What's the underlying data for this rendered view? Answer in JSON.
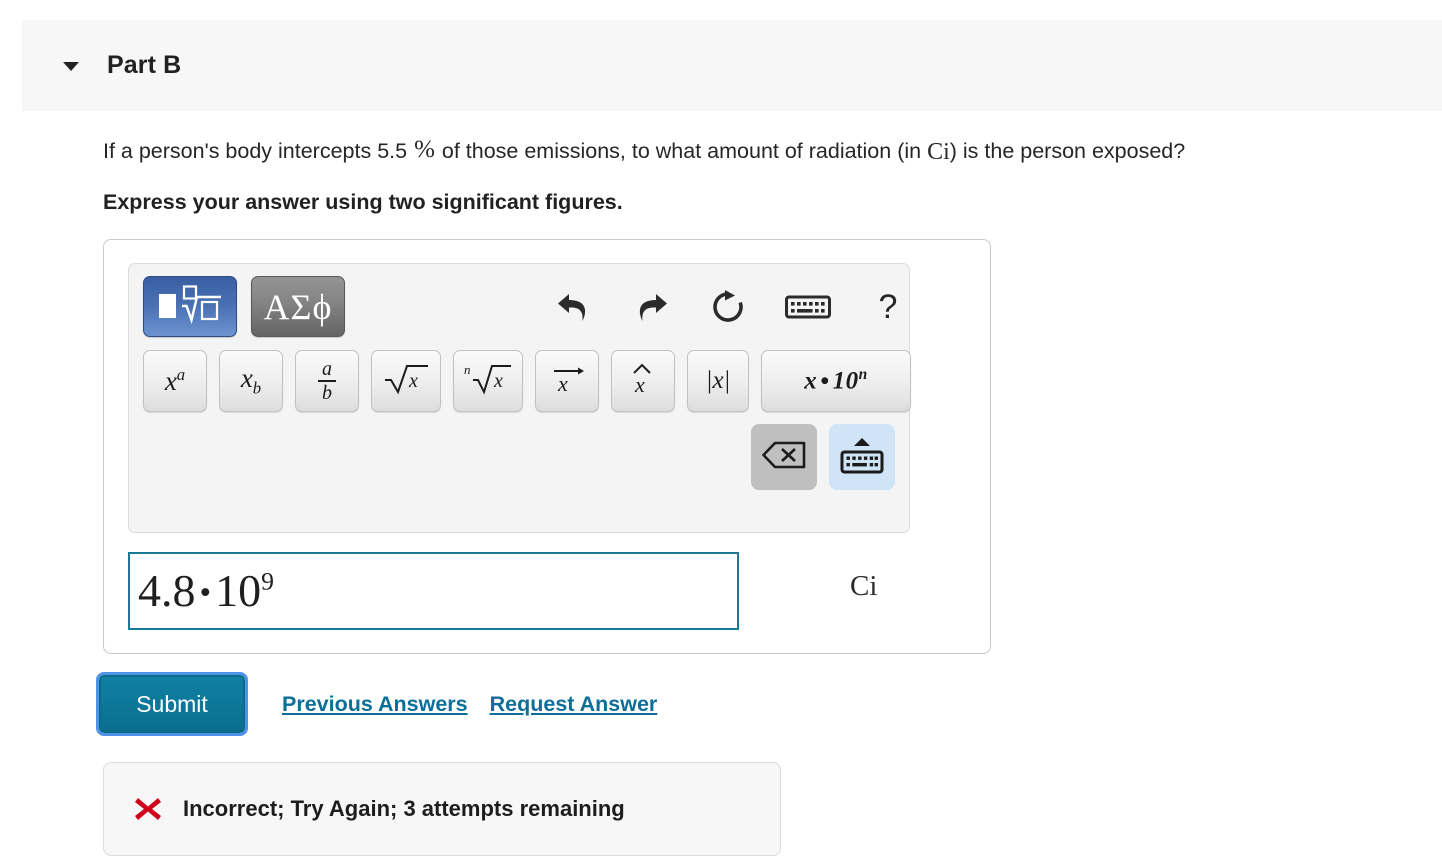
{
  "part": {
    "title": "Part B",
    "collapse_icon": "chevron-down-icon",
    "expanded": true
  },
  "question": {
    "text_before_percent": "If a person's body intercepts 5.5 ",
    "percent_symbol": "%",
    "text_middle": " of those emissions, to what amount of radiation (in ",
    "unit_inline": "Ci",
    "text_after": ") is the person exposed?",
    "prompt": "Express your answer using two significant figures."
  },
  "math_toolbar": {
    "mode_buttons": [
      {
        "name": "math-templates-mode",
        "label": "math-template-icon",
        "active": true,
        "color": "#4a72b5"
      },
      {
        "name": "greek-symbols-mode",
        "label": "ΑΣϕ",
        "active": false,
        "color": "#7c7c7c"
      }
    ],
    "action_icons": [
      {
        "name": "undo-icon",
        "title": "Undo"
      },
      {
        "name": "redo-icon",
        "title": "Redo"
      },
      {
        "name": "reset-icon",
        "title": "Reset"
      },
      {
        "name": "keyboard-icon",
        "title": "Keyboard"
      },
      {
        "name": "help-icon",
        "title": "?"
      }
    ],
    "help_glyph": "?",
    "templates": [
      {
        "name": "superscript-template",
        "base": "x",
        "sup": "a"
      },
      {
        "name": "subscript-template",
        "base": "x",
        "sub": "b"
      },
      {
        "name": "fraction-template",
        "num": "a",
        "den": "b"
      },
      {
        "name": "square-root-template",
        "radicand": "x"
      },
      {
        "name": "nth-root-template",
        "index": "n",
        "radicand": "x"
      },
      {
        "name": "vector-template",
        "base": "x",
        "accent": "→"
      },
      {
        "name": "hat-template",
        "base": "x",
        "accent": "ˆ"
      },
      {
        "name": "absolute-value-template",
        "label": "|x|"
      },
      {
        "name": "scientific-notation-template",
        "base": "x",
        "mult": "•",
        "ten": "10",
        "exp": "n"
      }
    ],
    "controls": [
      {
        "name": "backspace-button",
        "label": "backspace-icon"
      },
      {
        "name": "toggle-keyboard-button",
        "label": "keyboard-up-icon"
      }
    ]
  },
  "answer": {
    "value_mantissa": "4.8",
    "value_operator": "•",
    "value_base": "10",
    "value_exponent": "9",
    "unit": "Ci",
    "border_color": "#1a7a96"
  },
  "actions": {
    "submit_label": "Submit",
    "previous_answers_label": "Previous Answers",
    "request_answer_label": "Request Answer",
    "submit_color": "#0d7799",
    "link_color": "#0b6f99"
  },
  "feedback": {
    "icon": "x-mark-icon",
    "icon_color": "#d0021b",
    "message": "Incorrect; Try Again; 3 attempts remaining"
  }
}
